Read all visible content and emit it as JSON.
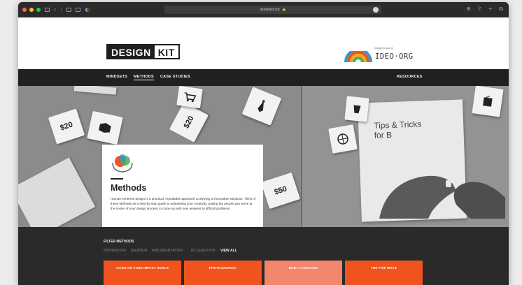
{
  "browser": {
    "url": "designkit.org",
    "traffic_colors": [
      "#ff5f57",
      "#febc2e",
      "#28c840"
    ]
  },
  "header": {
    "logo_left": "DESIGN",
    "logo_right": "KIT",
    "brought_by": "brought to you by",
    "partner": "IDEO·ORG"
  },
  "nav": {
    "mindsets": "MINDSETS",
    "methods": "METHODS",
    "case_studies": "CASE STUDIES",
    "resources": "RESOURCES"
  },
  "hero": {
    "title": "Methods",
    "description": "Human-centered design is a practical, repeatable approach to arriving at innovative solutions. Think of these Methods as a step-by-step guide to unleashing your creativity, putting the people you serve at the center of your design process to come up with new answers to difficult problems.",
    "card_labels": [
      "$20",
      "$20",
      "$50"
    ],
    "tips_line1": "Tips & Tricks",
    "tips_line2": "for B"
  },
  "filter": {
    "title": "FILTER METHODS",
    "options": [
      "INSPIRATION",
      "IDEATION",
      "IMPLEMENTATION",
      "BY QUESTION",
      "VIEW ALL"
    ],
    "active": "VIEW ALL"
  },
  "tiles": [
    {
      "label": "ALIGN ON YOUR IMPACT GOALS"
    },
    {
      "label": "PHOTOJOURNAL"
    },
    {
      "label": "BODY LANGUAGE"
    },
    {
      "label": "THE FIVE WHYS"
    }
  ],
  "colors": {
    "accent": "#f0531e",
    "dark": "#202020"
  }
}
